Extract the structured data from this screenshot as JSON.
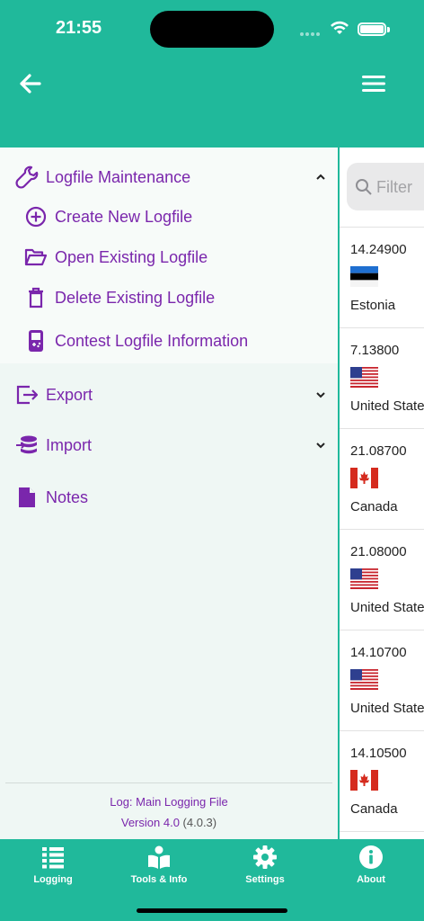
{
  "status_bar": {
    "time": "21:55"
  },
  "header": {
    "back_icon": "arrow-left-icon",
    "menu_icon": "hamburger-menu-icon"
  },
  "drawer": {
    "sections": [
      {
        "label": "Logfile Maintenance",
        "icon": "wrench-icon",
        "expanded": true,
        "items": [
          {
            "label": "Create New Logfile",
            "icon": "plus-circle-icon"
          },
          {
            "label": "Open Existing Logfile",
            "icon": "folder-open-icon"
          },
          {
            "label": "Delete Existing Logfile",
            "icon": "trash-icon"
          },
          {
            "label": "Contest Logfile Information",
            "icon": "game-device-icon"
          }
        ]
      },
      {
        "label": "Export",
        "icon": "export-icon",
        "expanded": false
      },
      {
        "label": "Import",
        "icon": "database-import-icon",
        "expanded": false
      },
      {
        "label": "Notes",
        "icon": "note-icon"
      }
    ],
    "footer": {
      "log_line": "Log: Main Logging File",
      "version_prefix": "Version 4.0",
      "version_build": "(4.0.3)"
    }
  },
  "log_list": {
    "filter_placeholder": "Filter",
    "entries": [
      {
        "frequency": "14.24900",
        "country": "Estonia",
        "flag": "estonia-flag"
      },
      {
        "frequency": "7.13800",
        "country": "United States",
        "flag": "usa-flag"
      },
      {
        "frequency": "21.08700",
        "country": "Canada",
        "flag": "canada-flag"
      },
      {
        "frequency": "21.08000",
        "country": "United States",
        "flag": "usa-flag"
      },
      {
        "frequency": "14.10700",
        "country": "United States",
        "flag": "usa-flag"
      },
      {
        "frequency": "14.10500",
        "country": "Canada",
        "flag": "canada-flag"
      }
    ]
  },
  "tab_bar": {
    "tabs": [
      {
        "label": "Logging",
        "icon": "list-icon"
      },
      {
        "label": "Tools & Info",
        "icon": "book-reader-icon"
      },
      {
        "label": "Settings",
        "icon": "gear-icon"
      },
      {
        "label": "About",
        "icon": "info-circle-icon"
      }
    ]
  },
  "colors": {
    "primary": "#20b99b",
    "accent": "#7a26ac",
    "drawer_bg": "#eff7f4"
  }
}
